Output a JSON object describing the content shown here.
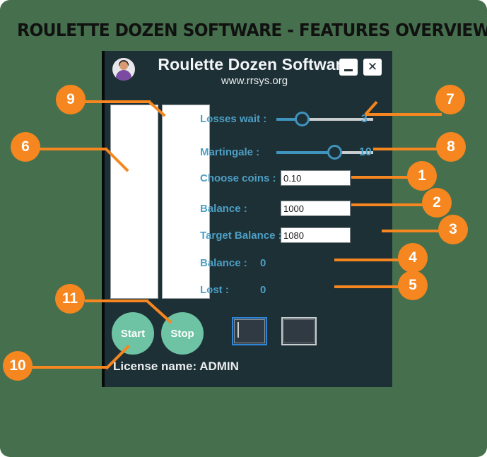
{
  "page": {
    "title": "ROULETTE DOZEN SOFTWARE  - FEATURES OVERVIEW",
    "background_color": "#46704d",
    "accent_color": "#f6861f"
  },
  "window": {
    "avatar_icon": "user-avatar-icon",
    "app_title": "Roulette Dozen Software",
    "url": "www.rrsys.org",
    "background_color": "#1d3036",
    "minimize_icon": "minimize-icon",
    "close_icon": "close-icon"
  },
  "panels": {
    "list_a": "",
    "list_b": ""
  },
  "settings": {
    "losses_wait": {
      "label": "Losses wait :",
      "value": "3",
      "percent": 26
    },
    "martingale": {
      "label": "Martingale :",
      "value": "10",
      "percent": 60
    },
    "choose_coins": {
      "label": "Choose coins :",
      "value": "0.10"
    },
    "balance_input": {
      "label": "Balance :",
      "value": "1000"
    },
    "target_balance": {
      "label": "Target Balance :",
      "value": "1080"
    },
    "balance_readout": {
      "label": "Balance :",
      "value": "0"
    },
    "lost_readout": {
      "label": "Lost :",
      "value": "0"
    }
  },
  "actions": {
    "start_label": "Start",
    "stop_label": "Stop",
    "button_color": "#6dc3a3",
    "log_box_a": "",
    "log_box_b": ""
  },
  "license": {
    "text": "License name:  ADMIN"
  },
  "callouts": [
    {
      "number": "1"
    },
    {
      "number": "2"
    },
    {
      "number": "3"
    },
    {
      "number": "4"
    },
    {
      "number": "5"
    },
    {
      "number": "6"
    },
    {
      "number": "7"
    },
    {
      "number": "8"
    },
    {
      "number": "9"
    },
    {
      "number": "10"
    },
    {
      "number": "11"
    }
  ]
}
